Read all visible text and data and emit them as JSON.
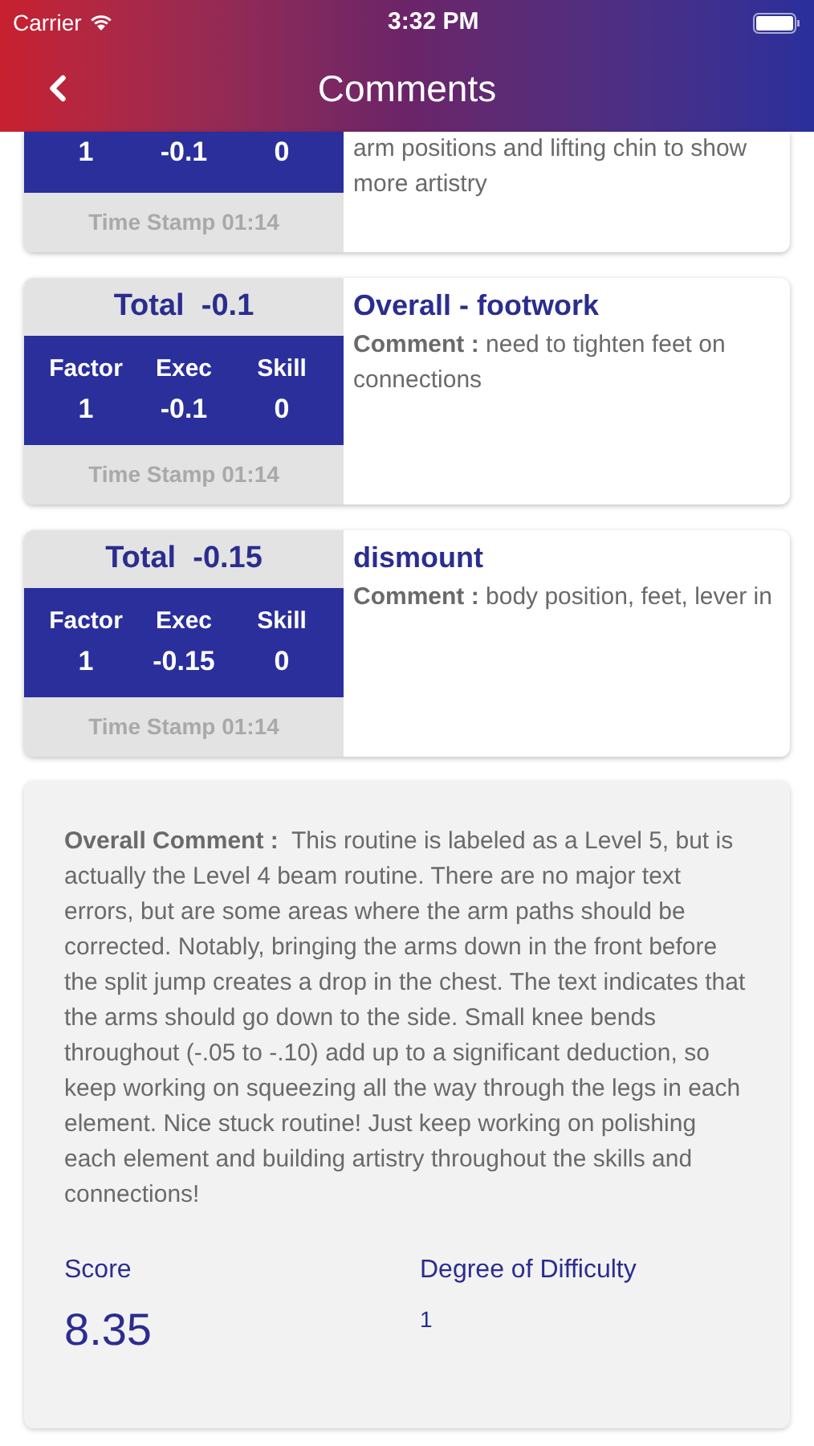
{
  "status_bar": {
    "carrier": "Carrier",
    "time": "3:32 PM"
  },
  "nav": {
    "title": "Comments"
  },
  "cards": [
    {
      "partial": true,
      "factor": "1",
      "exec": "-0.1",
      "skill": "0",
      "time_stamp": "Time Stamp 01:14",
      "comment": "arm positions and lifting chin to show more artistry"
    },
    {
      "partial": false,
      "total": "Total  -0.1",
      "factor_label": "Factor",
      "exec_label": "Exec",
      "skill_label": "Skill",
      "factor": "1",
      "exec": "-0.1",
      "skill": "0",
      "time_stamp": "Time Stamp 01:14",
      "title": "Overall - footwork",
      "comment": "**Comment :** need to tighten feet on connections"
    },
    {
      "partial": false,
      "total": "Total  -0.15",
      "factor_label": "Factor",
      "exec_label": "Exec",
      "skill_label": "Skill",
      "factor": "1",
      "exec": "-0.15",
      "skill": "0",
      "time_stamp": "Time Stamp 01:14",
      "title": "dismount",
      "comment": "**Comment :** body position, feet, lever in"
    }
  ],
  "overall": {
    "comment": "**Overall Comment :**  This routine is labeled as a Level 5, but is actually the Level 4 beam routine. There are no major text errors, but are some areas where the arm paths should be corrected. Notably, bringing the arms down in the front before the split jump creates a drop in the chest. The text indicates that the arms should go down to the side. Small knee bends throughout (-.05 to -.10) add up to a significant deduction, so keep working on squeezing all the way through the legs in each element. Nice stuck routine! Just keep working on polishing each element and building artistry throughout the skills and connections!",
    "score_label": "Score",
    "score": "8.35",
    "difficulty_label": "Degree of Difficulty",
    "difficulty": "1"
  }
}
